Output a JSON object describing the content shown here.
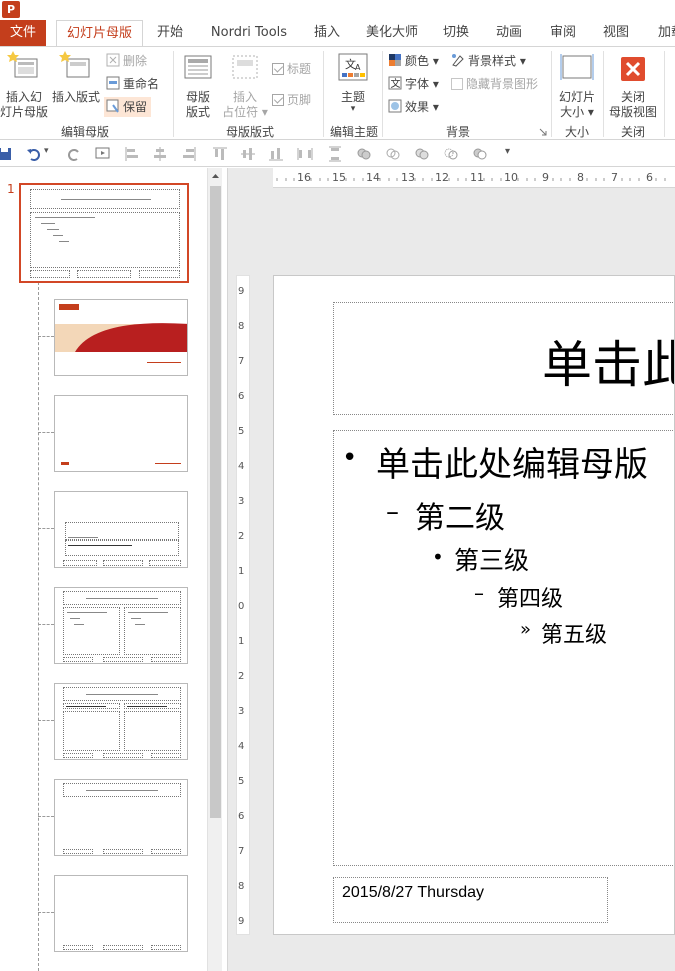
{
  "app": {
    "icon_letter": "P"
  },
  "tabs": [
    {
      "label": "文件"
    },
    {
      "label": "幻灯片母版"
    },
    {
      "label": "开始"
    },
    {
      "label": "Nordri Tools"
    },
    {
      "label": "插入"
    },
    {
      "label": "美化大师"
    },
    {
      "label": "切换"
    },
    {
      "label": "动画"
    },
    {
      "label": "审阅"
    },
    {
      "label": "视图"
    },
    {
      "label": "加载"
    }
  ],
  "ribbon": {
    "edit_master": {
      "label": "编辑母版",
      "insert_slide_master": "插入幻灯片母版",
      "insert_slide_master_l1": "插入幻",
      "insert_slide_master_l2": "灯片母版",
      "insert_layout": "插入版式",
      "delete": "删除",
      "rename": "重命名",
      "preserve": "保留"
    },
    "master_layout": {
      "label": "母版版式",
      "master_layout_l1": "母版",
      "master_layout_l2": "版式",
      "insert_placeholder_l1": "插入",
      "insert_placeholder_l2": "占位符",
      "title": "标题",
      "footer": "页脚"
    },
    "edit_theme": {
      "label": "编辑主题",
      "theme": "主题"
    },
    "background": {
      "label": "背景",
      "colors": "颜色",
      "fonts": "字体",
      "effects": "效果",
      "background_styles": "背景样式",
      "hide_background_graphics": "隐藏背景图形"
    },
    "size": {
      "label": "大小",
      "slide_size_l1": "幻灯片",
      "slide_size_l2": "大小"
    },
    "close": {
      "label": "关闭",
      "close_master_l1": "关闭",
      "close_master_l2": "母版视图"
    }
  },
  "thumbnails": {
    "master_number": "1"
  },
  "rulers": {
    "horizontal": [
      "16",
      "15",
      "14",
      "13",
      "12",
      "11",
      "10",
      "9",
      "8",
      "7",
      "6"
    ],
    "vertical": [
      "9",
      "8",
      "7",
      "6",
      "5",
      "4",
      "3",
      "2",
      "1",
      "0",
      "1",
      "2",
      "3",
      "4",
      "5",
      "6",
      "7",
      "8",
      "9"
    ]
  },
  "slide": {
    "title_text": "单击此",
    "body": {
      "level1": "单击此处编辑母版",
      "level2": "第二级",
      "level3": "第三级",
      "level4": "第四级",
      "level5": "第五级"
    },
    "date_text": "2015/8/27 Thursday"
  },
  "colors": {
    "accent": "#c43e1c",
    "selection_border": "#d24726",
    "close_button": "#e04c2e"
  }
}
